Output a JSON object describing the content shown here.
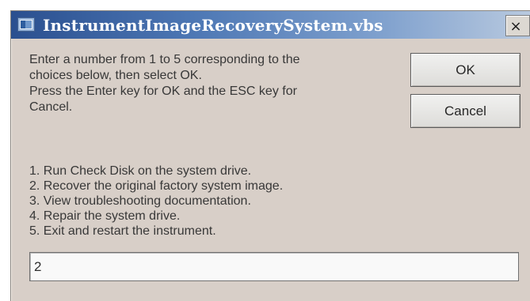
{
  "window": {
    "title": "InstrumentImageRecoverySystem.vbs",
    "close_label": "×",
    "app_icon_name": "vbscript-window-icon"
  },
  "prompt": {
    "lines": [
      "Enter a number from 1 to 5 corresponding to the",
      "choices below, then select OK.",
      "Press the Enter key for OK and the ESC key for",
      "Cancel."
    ]
  },
  "choices": [
    "1. Run Check Disk on the system drive.",
    "2. Recover the original factory system image.",
    "3. View troubleshooting documentation.",
    "4. Repair the system drive.",
    "5. Exit and restart the instrument."
  ],
  "buttons": {
    "ok_label": "OK",
    "cancel_label": "Cancel"
  },
  "input": {
    "value": "2"
  }
}
